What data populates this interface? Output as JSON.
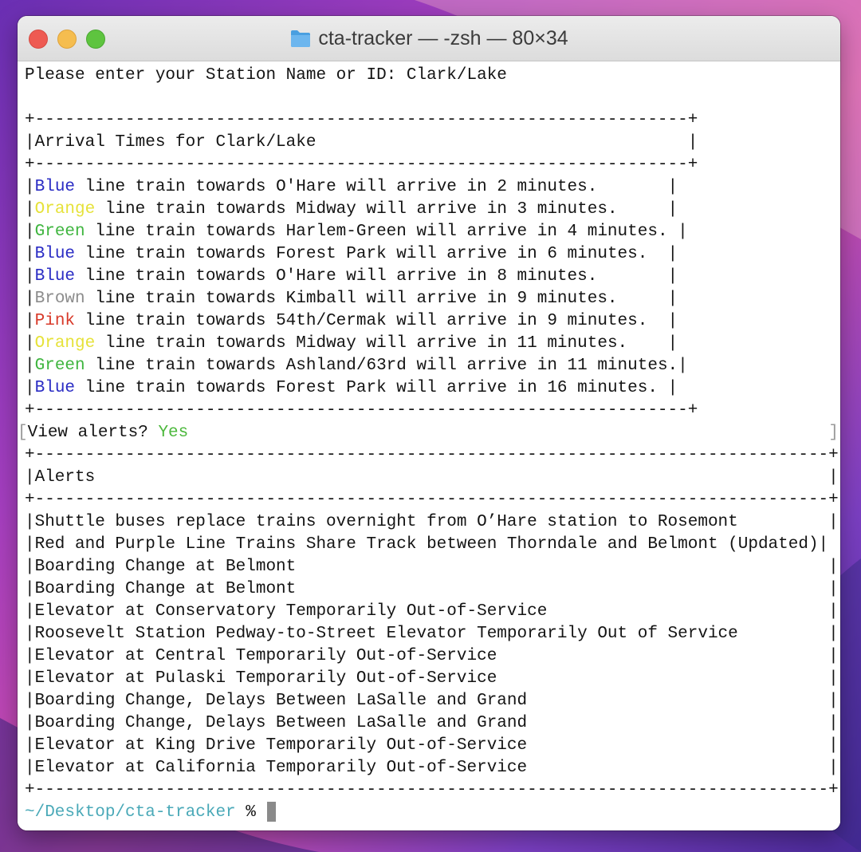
{
  "window": {
    "title": "cta-tracker — -zsh — 80×34"
  },
  "icons": {
    "titlebar": "folder-icon"
  },
  "colors": {
    "blue": "#2a2cc4",
    "orange": "#e6e23a",
    "green": "#3fb53f",
    "brown": "#8c8c8c",
    "pink": "#d83a2a",
    "yes": "#4cb83c",
    "prompt_path": "#4aa9b8"
  },
  "terminal": {
    "station_prompt": "Please enter your Station Name or ID: Clark/Lake",
    "arrivals": {
      "border": "+-----------------------------------------------------------------+",
      "header": "|Arrival Times for Clark/Lake                                     |",
      "rows": [
        {
          "line": "Blue",
          "rest": " line train towards O'Hare will arrive in 2 minutes.       |"
        },
        {
          "line": "Orange",
          "rest": " line train towards Midway will arrive in 3 minutes.     |"
        },
        {
          "line": "Green",
          "rest": " line train towards Harlem-Green will arrive in 4 minutes. |"
        },
        {
          "line": "Blue",
          "rest": " line train towards Forest Park will arrive in 6 minutes.  |"
        },
        {
          "line": "Blue",
          "rest": " line train towards O'Hare will arrive in 8 minutes.       |"
        },
        {
          "line": "Brown",
          "rest": " line train towards Kimball will arrive in 9 minutes.     |"
        },
        {
          "line": "Pink",
          "rest": " line train towards 54th/Cermak will arrive in 9 minutes.  |"
        },
        {
          "line": "Orange",
          "rest": " line train towards Midway will arrive in 11 minutes.    |"
        },
        {
          "line": "Green",
          "rest": " line train towards Ashland/63rd will arrive in 11 minutes.|"
        },
        {
          "line": "Blue",
          "rest": " line train towards Forest Park will arrive in 16 minutes. |"
        }
      ]
    },
    "alerts_question": {
      "label": "View alerts? ",
      "answer": "Yes",
      "bracket_left": "[",
      "bracket_right": "]"
    },
    "alerts": {
      "border": "+-------------------------------------------------------------------------------+",
      "header": "|Alerts                                                                         |",
      "rows": [
        "|Shuttle buses replace trains overnight from O’Hare station to Rosemont         |",
        "|Red and Purple Line Trains Share Track between Thorndale and Belmont (Updated)|",
        "|Boarding Change at Belmont                                                     |",
        "|Boarding Change at Belmont                                                     |",
        "|Elevator at Conservatory Temporarily Out-of-Service                            |",
        "|Roosevelt Station Pedway-to-Street Elevator Temporarily Out of Service         |",
        "|Elevator at Central Temporarily Out-of-Service                                 |",
        "|Elevator at Pulaski Temporarily Out-of-Service                                 |",
        "|Boarding Change, Delays Between LaSalle and Grand                              |",
        "|Boarding Change, Delays Between LaSalle and Grand                              |",
        "|Elevator at King Drive Temporarily Out-of-Service                              |",
        "|Elevator at California Temporarily Out-of-Service                              |"
      ]
    },
    "shell_prompt": {
      "path": "~/Desktop/cta-tracker",
      "symbol": " % "
    }
  }
}
